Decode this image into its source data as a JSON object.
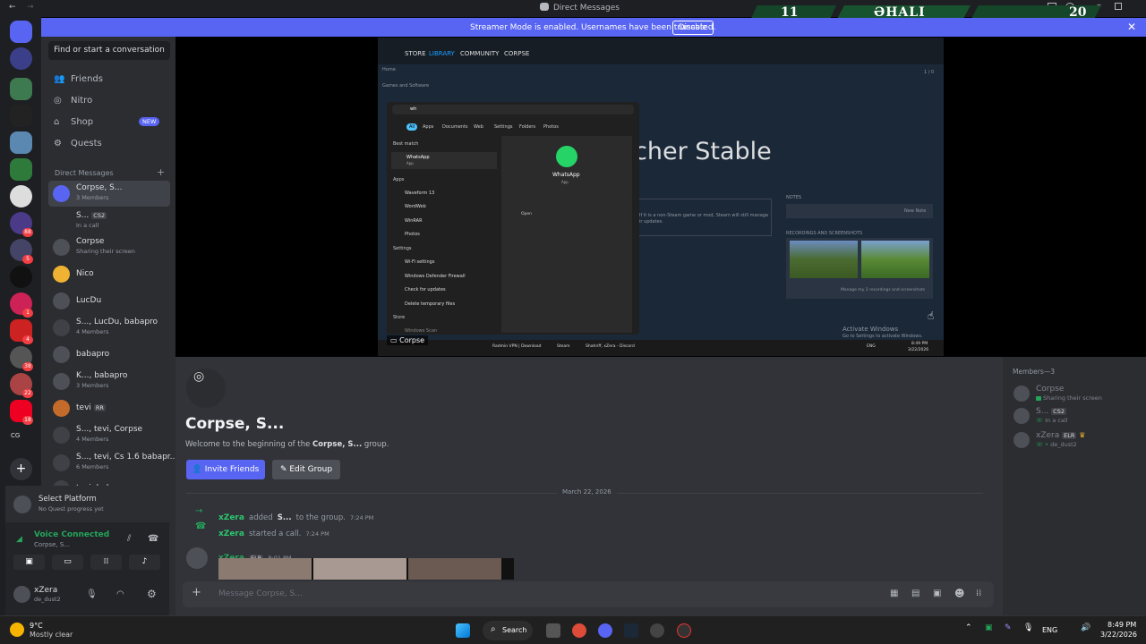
{
  "titlebar": {
    "title": "Direct Messages",
    "score_left": "11",
    "score_team": "ƏHALI",
    "score_right": "20"
  },
  "banner": {
    "text": "Streamer Mode is enabled. Usernames have been truncated.",
    "disable_label": "Disable"
  },
  "rail": {
    "badges": [
      "88",
      "5",
      "1",
      "4",
      "38",
      "22",
      "18"
    ],
    "cg_label": "CG"
  },
  "sidebar": {
    "search_label": "Find or start a conversation",
    "nav": [
      {
        "label": "Friends",
        "icon": "friends-icon"
      },
      {
        "label": "Nitro",
        "icon": "nitro-icon"
      },
      {
        "label": "Shop",
        "icon": "shop-icon",
        "badge": "NEW"
      },
      {
        "label": "Quests",
        "icon": "quests-icon"
      }
    ],
    "dm_header": "Direct Messages",
    "dms": [
      {
        "name": "Corpse, S...",
        "sub": "3 Members"
      },
      {
        "name": "S...",
        "tag": "CS2",
        "sub": "In a call"
      },
      {
        "name": "Corpse",
        "sub": "Sharing their screen"
      },
      {
        "name": "Nico",
        "sub": ""
      },
      {
        "name": "LucDu",
        "sub": ""
      },
      {
        "name": "S..., LucDu, babapro",
        "sub": "4 Members"
      },
      {
        "name": "babapro",
        "sub": ""
      },
      {
        "name": "K..., babapro",
        "sub": "3 Members"
      },
      {
        "name": "tevi",
        "tag": "RR",
        "sub": ""
      },
      {
        "name": "S..., tevi, Corpse",
        "sub": "4 Members"
      },
      {
        "name": "S..., tevi, Cs 1.6 babapr...",
        "sub": "6 Members"
      },
      {
        "name": "tevi, babapro",
        "sub": ""
      }
    ]
  },
  "platform": {
    "title": "Select Platform",
    "sub": "No Quest progress yet"
  },
  "voice": {
    "status": "Voice Connected",
    "channel": "Corpse, S..."
  },
  "user": {
    "name": "xZera",
    "status": "de_dust2"
  },
  "stream": {
    "nav": [
      "STORE",
      "LIBRARY",
      "COMMUNITY",
      "CORPSE"
    ],
    "home": "Home",
    "games_software": "Games and Software",
    "search_query": "wh",
    "filter_tabs": [
      "All",
      "Apps",
      "Documents",
      "Web",
      "Settings",
      "Folders",
      "Photos"
    ],
    "best_match": "Best match",
    "best_app": "WhatsApp",
    "best_app_sub": "App",
    "apps_label": "Apps",
    "apps": [
      "Waveform 13",
      "WordWeb",
      "WinRAR",
      "Photos"
    ],
    "settings_label": "Settings",
    "settings": [
      "Wi-Fi settings",
      "Windows Defender Firewall",
      "Check for updates",
      "Delete temporary files"
    ],
    "store_label": "Store",
    "store_item": "Windows Scan",
    "preview_name": "WhatsApp",
    "preview_sub": "App",
    "open_label": "Open",
    "big_title": "cher Stable",
    "notes_label": "NOTES",
    "new_note": "New Note",
    "recordings_label": "RECORDINGS AND SCREENSHOTS",
    "manage_label": "Manage my 2 recordings and screenshots",
    "steam_msg": "If it is a non-Steam game or mod, Steam will still manage",
    "steam_msg2": "ir updates.",
    "activate1": "Activate Windows",
    "activate2": "Go to Settings to activate Windows.",
    "stream_label": "Corpse",
    "inner_taskbar": [
      "Radmin VPN | Download",
      "Steam",
      "Shahriff, xZera - Discord"
    ],
    "inner_clock": "8:49 PM",
    "inner_date": "3/22/2026",
    "inner_lang": "ENG",
    "inner_page": "1 / 0"
  },
  "chat": {
    "group_name": "Corpse, S...",
    "welcome_pre": "Welcome to the beginning of the ",
    "welcome_bold": "Corpse, S...",
    "welcome_post": " group.",
    "invite_label": "Invite Friends",
    "edit_label": "Edit Group",
    "date_divider": "March 22, 2026",
    "sys1_name": "xZera",
    "sys1_text": "added",
    "sys1_target": "S...",
    "sys1_rest": "to the group.",
    "sys1_time": "7:24 PM",
    "sys2_name": "xZera",
    "sys2_text": "started a call.",
    "sys2_time": "7:24 PM",
    "msg_name": "xZera",
    "msg_tag": "ELR",
    "msg_time": "8:01 PM",
    "composer_placeholder": "Message Corpse, S..."
  },
  "members": {
    "header": "Members—3",
    "list": [
      {
        "name": "Corpse",
        "sub": "Sharing their screen"
      },
      {
        "name": "S...",
        "tag": "CS2",
        "sub": "In a call"
      },
      {
        "name": "xZera",
        "tag": "ELR",
        "sub": "de_dust2"
      }
    ]
  },
  "taskbar": {
    "weather_temp": "9°C",
    "weather_desc": "Mostly clear",
    "search_label": "Search",
    "lang": "ENG",
    "time": "8:49 PM",
    "date": "3/22/2026"
  }
}
